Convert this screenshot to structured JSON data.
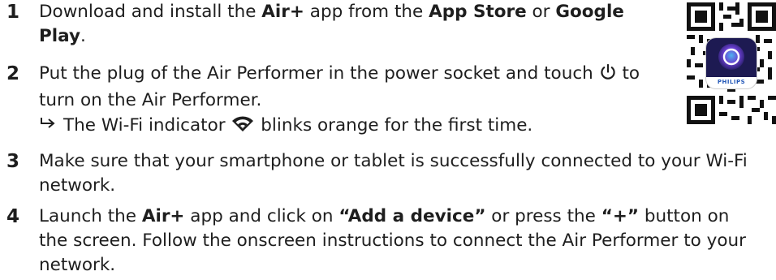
{
  "steps": [
    {
      "number": "1",
      "lines": {
        "part1": "Download and install the ",
        "part2": "Air+",
        "part3": " app from the ",
        "part4": "App Store",
        "part5": " or ",
        "part6": "Google Play",
        "part7": "."
      }
    },
    {
      "number": "2",
      "lines": {
        "part1": "Put the plug of the Air Performer in the power socket and touch ",
        "part2": " to turn on the Air Performer."
      },
      "substep": {
        "part1": "The Wi-Fi indicator ",
        "part2": " blinks orange for the first time."
      }
    },
    {
      "number": "3",
      "text": "Make sure that your smartphone or tablet is successfully connected to your Wi-Fi network."
    },
    {
      "number": "4",
      "lines": {
        "part1": "Launch the ",
        "part2": "Air+",
        "part3": " app and click on ",
        "part4": "“Add a device”",
        "part5": " or press the ",
        "part6": "“+”",
        "part7": " button on the screen. Follow the onscreen instructions to connect the Air Performer to your network."
      }
    }
  ],
  "icons": {
    "power": "power-icon",
    "wifi": "wifi-icon",
    "arrow": "result-arrow-icon",
    "qr": "qr-code",
    "app": "air-plus-app-icon"
  },
  "qr_app_label": "PHILIPS",
  "colors": {
    "text": "#1e1e1e",
    "app_blue": "#2458b8",
    "app_purple": "#6a3fd0"
  }
}
